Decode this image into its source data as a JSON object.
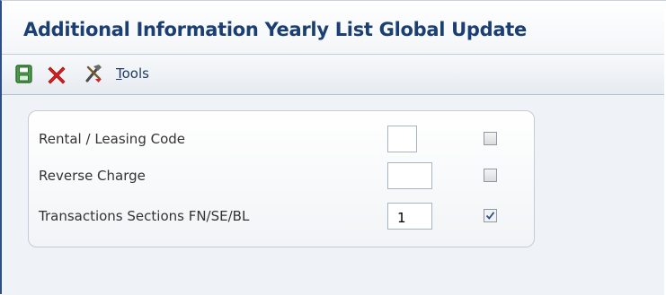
{
  "header": {
    "title": "Additional Information Yearly List Global Update"
  },
  "toolbar": {
    "tools_label_mnemonic": "T",
    "tools_label_rest": "ools",
    "icons": [
      "save-icon",
      "cancel-icon",
      "tools-icon"
    ]
  },
  "form": {
    "rows": [
      {
        "label": "Rental / Leasing Code",
        "value": "",
        "checked": false
      },
      {
        "label": "Reverse Charge",
        "value": "",
        "checked": false
      },
      {
        "label": "Transactions Sections FN/SE/BL",
        "value": "1",
        "checked": true
      }
    ]
  },
  "colors": {
    "title": "#1b3f73",
    "cancel": "#d42020",
    "save": "#3c8c3c",
    "panel_border": "#c3ccd8"
  }
}
